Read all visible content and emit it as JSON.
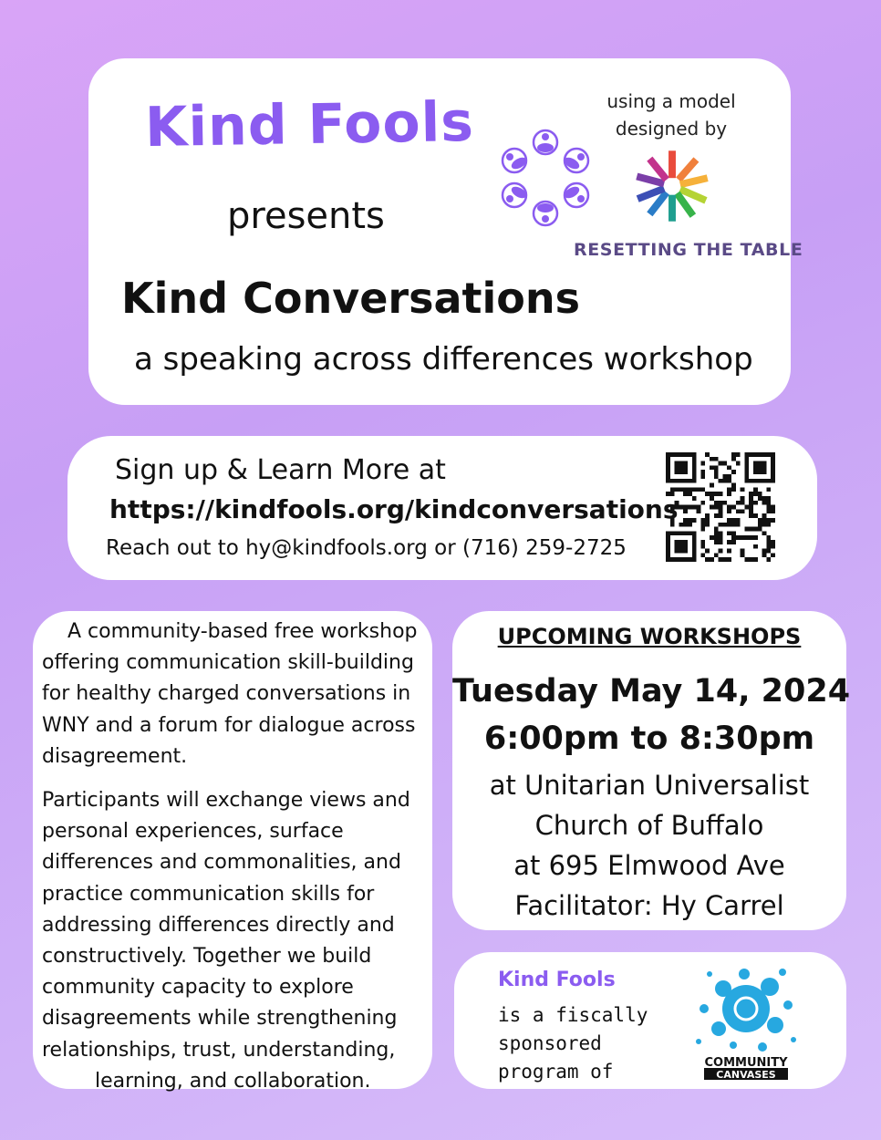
{
  "hero": {
    "brand": "Kind Fools",
    "presents": "presents",
    "model_line1": "using a model",
    "model_line2": "designed by",
    "partner": "RESETTING THE TABLE",
    "title": "Kind Conversations",
    "subtitle": "a speaking across differences workshop"
  },
  "signup": {
    "label": "Sign up & Learn More at",
    "url": "https://kindfools.org/kindconversations",
    "contact": "Reach out to hy@kindfools.org or (716) 259-2725"
  },
  "about": {
    "p1": "A community-based free workshop offering communication skill-building for healthy charged conversations in WNY and a forum for dialogue across disagreement.",
    "p2": "Participants will exchange views and personal experiences, surface differences and commonalities, and practice communication skills for addressing differences directly and constructively. Together we build community capacity to explore disagreements while strengthening relationships, trust, understanding,",
    "p2_last": "learning, and collaboration."
  },
  "workshops": {
    "heading": "UPCOMING WORKSHOPS",
    "date": "Tuesday May 14, 2024",
    "time": "6:00pm to 8:30pm",
    "location1": "at Unitarian Universalist",
    "location2": "Church of Buffalo",
    "address": "at 695 Elmwood Ave",
    "facilitator": "Facilitator: Hy Carrel"
  },
  "sponsor": {
    "brand": "Kind Fools",
    "text": "is a fiscally\nsponsored\nprogram of",
    "logo_line1": "COMMUNITY",
    "logo_line2": "CANVASES"
  },
  "colors": {
    "brand_purple": "#8b5cf0",
    "partner_text": "#5a4a86",
    "splash_blue": "#27a8e0"
  }
}
